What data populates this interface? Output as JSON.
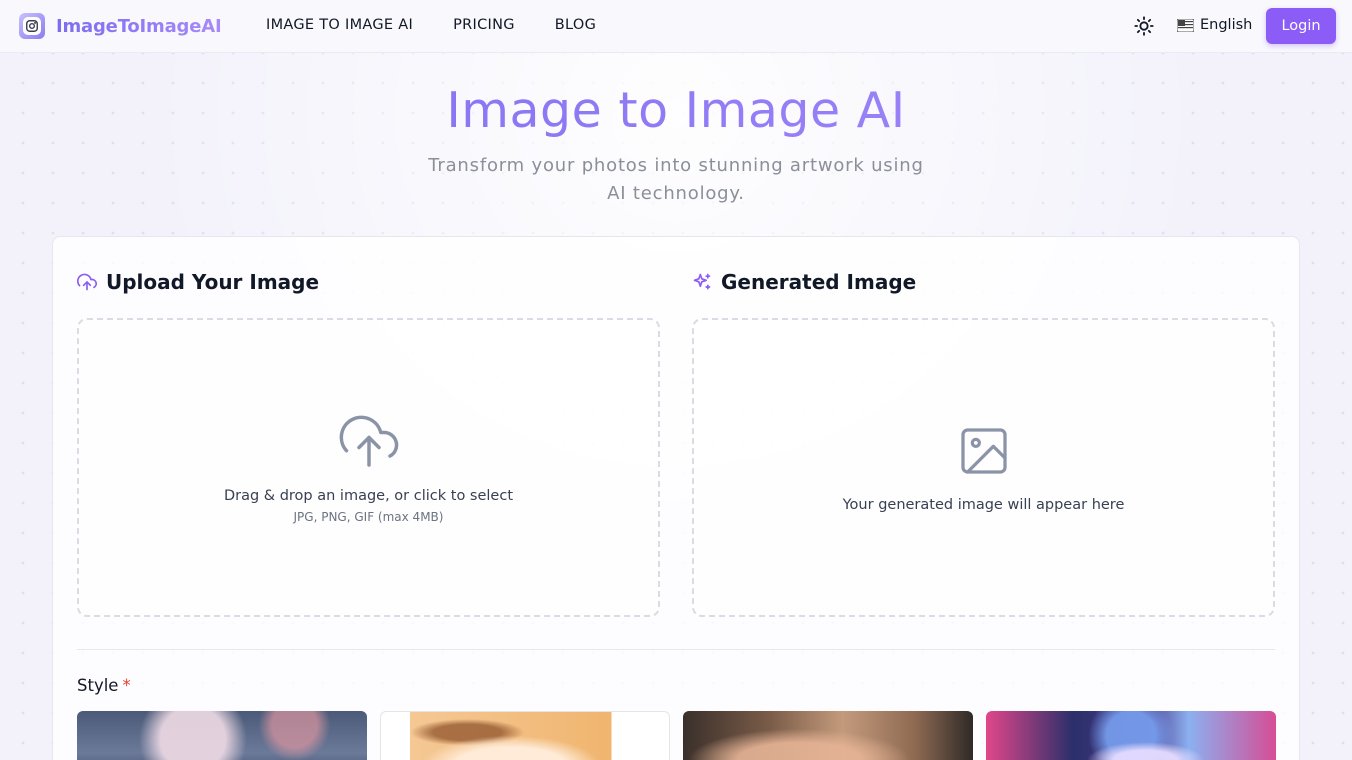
{
  "header": {
    "brand": "ImageToImageAI",
    "nav": [
      "IMAGE TO IMAGE AI",
      "PRICING",
      "BLOG"
    ],
    "language": "English",
    "login_label": "Login",
    "theme_icon": "sun-icon",
    "flag_icon": "flag-icon"
  },
  "hero": {
    "title": "Image to Image AI",
    "subtitle": "Transform your photos into stunning artwork using AI technology."
  },
  "upload": {
    "title": "Upload Your Image",
    "icon": "cloud-upload-icon",
    "drop_text": "Drag & drop an image, or click to select",
    "formats": "JPG, PNG, GIF (max 4MB)"
  },
  "generated": {
    "title": "Generated Image",
    "icon": "sparkles-icon",
    "placeholder": "Your generated image will appear here"
  },
  "style": {
    "label": "Style",
    "required_mark": "*",
    "thumbnails": [
      "anime-style-thumbnail",
      "chibi-style-thumbnail",
      "realistic-style-thumbnail",
      "cyberpunk-style-thumbnail"
    ]
  },
  "colors": {
    "accent": "#8b5cf6",
    "required": "#e0412c"
  }
}
